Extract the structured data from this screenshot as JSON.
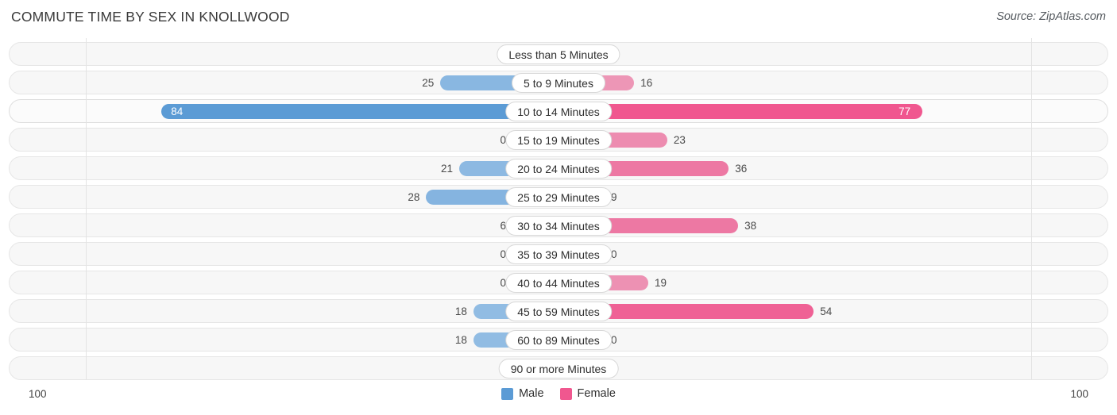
{
  "header": {
    "title": "COMMUTE TIME BY SEX IN KNOLLWOOD",
    "source": "Source: ZipAtlas.com"
  },
  "legend": {
    "items": [
      {
        "label": "Male",
        "color": "#5b9bd5"
      },
      {
        "label": "Female",
        "color": "#f0578f"
      }
    ]
  },
  "axis": {
    "left_end": "100",
    "right_end": "100"
  },
  "chart_data": {
    "type": "bar",
    "subtype": "diverging-bar",
    "title": "COMMUTE TIME BY SEX IN KNOLLWOOD",
    "xlabel": "",
    "ylabel": "",
    "xlim": [
      100,
      100
    ],
    "grid": true,
    "legend_position": "bottom-center",
    "categories": [
      "Less than 5 Minutes",
      "5 to 9 Minutes",
      "10 to 14 Minutes",
      "15 to 19 Minutes",
      "20 to 24 Minutes",
      "25 to 29 Minutes",
      "30 to 34 Minutes",
      "35 to 39 Minutes",
      "40 to 44 Minutes",
      "45 to 59 Minutes",
      "60 to 89 Minutes",
      "90 or more Minutes"
    ],
    "series": [
      {
        "name": "Male",
        "color": "#5b9bd5",
        "values": [
          0,
          25,
          84,
          0,
          21,
          28,
          6,
          0,
          0,
          18,
          18,
          0
        ]
      },
      {
        "name": "Female",
        "color": "#f0578f",
        "values": [
          0,
          16,
          77,
          23,
          36,
          9,
          38,
          0,
          19,
          54,
          0,
          0
        ]
      }
    ],
    "highlight_row": "10 to 14 Minutes"
  },
  "rows": [
    {
      "category": "Less than 5 Minutes",
      "male": "0",
      "female": "0",
      "male_value": 0,
      "female_value": 0,
      "highlight": false
    },
    {
      "category": "5 to 9 Minutes",
      "male": "25",
      "female": "16",
      "male_value": 25,
      "female_value": 16,
      "highlight": false
    },
    {
      "category": "10 to 14 Minutes",
      "male": "84",
      "female": "77",
      "male_value": 84,
      "female_value": 77,
      "highlight": true
    },
    {
      "category": "15 to 19 Minutes",
      "male": "0",
      "female": "23",
      "male_value": 0,
      "female_value": 23,
      "highlight": false
    },
    {
      "category": "20 to 24 Minutes",
      "male": "21",
      "female": "36",
      "male_value": 21,
      "female_value": 36,
      "highlight": false
    },
    {
      "category": "25 to 29 Minutes",
      "male": "28",
      "female": "9",
      "male_value": 28,
      "female_value": 9,
      "highlight": false
    },
    {
      "category": "30 to 34 Minutes",
      "male": "6",
      "female": "38",
      "male_value": 6,
      "female_value": 38,
      "highlight": false
    },
    {
      "category": "35 to 39 Minutes",
      "male": "0",
      "female": "0",
      "male_value": 0,
      "female_value": 0,
      "highlight": false
    },
    {
      "category": "40 to 44 Minutes",
      "male": "0",
      "female": "19",
      "male_value": 0,
      "female_value": 19,
      "highlight": false
    },
    {
      "category": "45 to 59 Minutes",
      "male": "18",
      "female": "54",
      "male_value": 18,
      "female_value": 54,
      "highlight": false
    },
    {
      "category": "60 to 89 Minutes",
      "male": "18",
      "female": "0",
      "male_value": 18,
      "female_value": 0,
      "highlight": false
    },
    {
      "category": "90 or more Minutes",
      "male": "0",
      "female": "0",
      "male_value": 0,
      "female_value": 0,
      "highlight": false
    }
  ]
}
